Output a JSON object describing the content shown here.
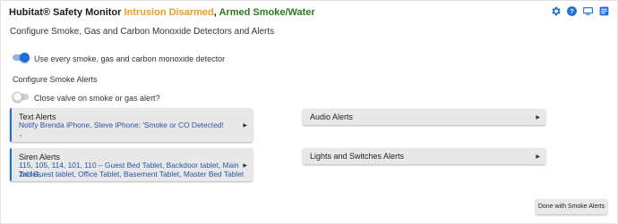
{
  "header": {
    "app_title": "Hubitat® Safety Monitor",
    "status_intrusion": "Intrusion Disarmed",
    "status_separator": ",",
    "status_armed": "Armed Smoke/Water",
    "icons": [
      "gear-icon",
      "help-icon",
      "monitor-icon",
      "logs-icon"
    ]
  },
  "page": {
    "subtitle": "Configure Smoke, Gas and Carbon Monoxide Detectors and Alerts"
  },
  "toggles": {
    "use_every_detector": {
      "label": "Use every smoke, gas and carbon monoxide detector",
      "on": true
    },
    "close_valve": {
      "label": "Close valve on smoke or gas alert?",
      "on": false
    }
  },
  "section": {
    "configure_alerts": "Configure Smoke Alerts"
  },
  "panels": {
    "text_alerts": {
      "title": "Text Alerts",
      "description": "Notify Brenda iPhone, Steve iPhone: 'Smoke or CO Detected!",
      "trailing": ","
    },
    "siren_alerts": {
      "title": "Siren Alerts",
      "description_line1": "115, 105, 114, 101, 110 – Guest Bed Tablet, Backdoor tablet, Main Tablet,",
      "description_line2": "2nd Guest tablet, Office Tablet, Basement Tablet, Master Bed Tablet"
    },
    "audio_alerts": {
      "title": "Audio Alerts"
    },
    "lights_switches_alerts": {
      "title": "Lights and Switches Alerts"
    }
  },
  "buttons": {
    "done": "Done with Smoke Alerts"
  },
  "colors": {
    "accent": "#1f6fd6",
    "intrusion_status": "#ee9a1b",
    "armed_status": "#2a7a1e",
    "link_text": "#2a54a8",
    "panel_bg": "#e8e8e8"
  }
}
